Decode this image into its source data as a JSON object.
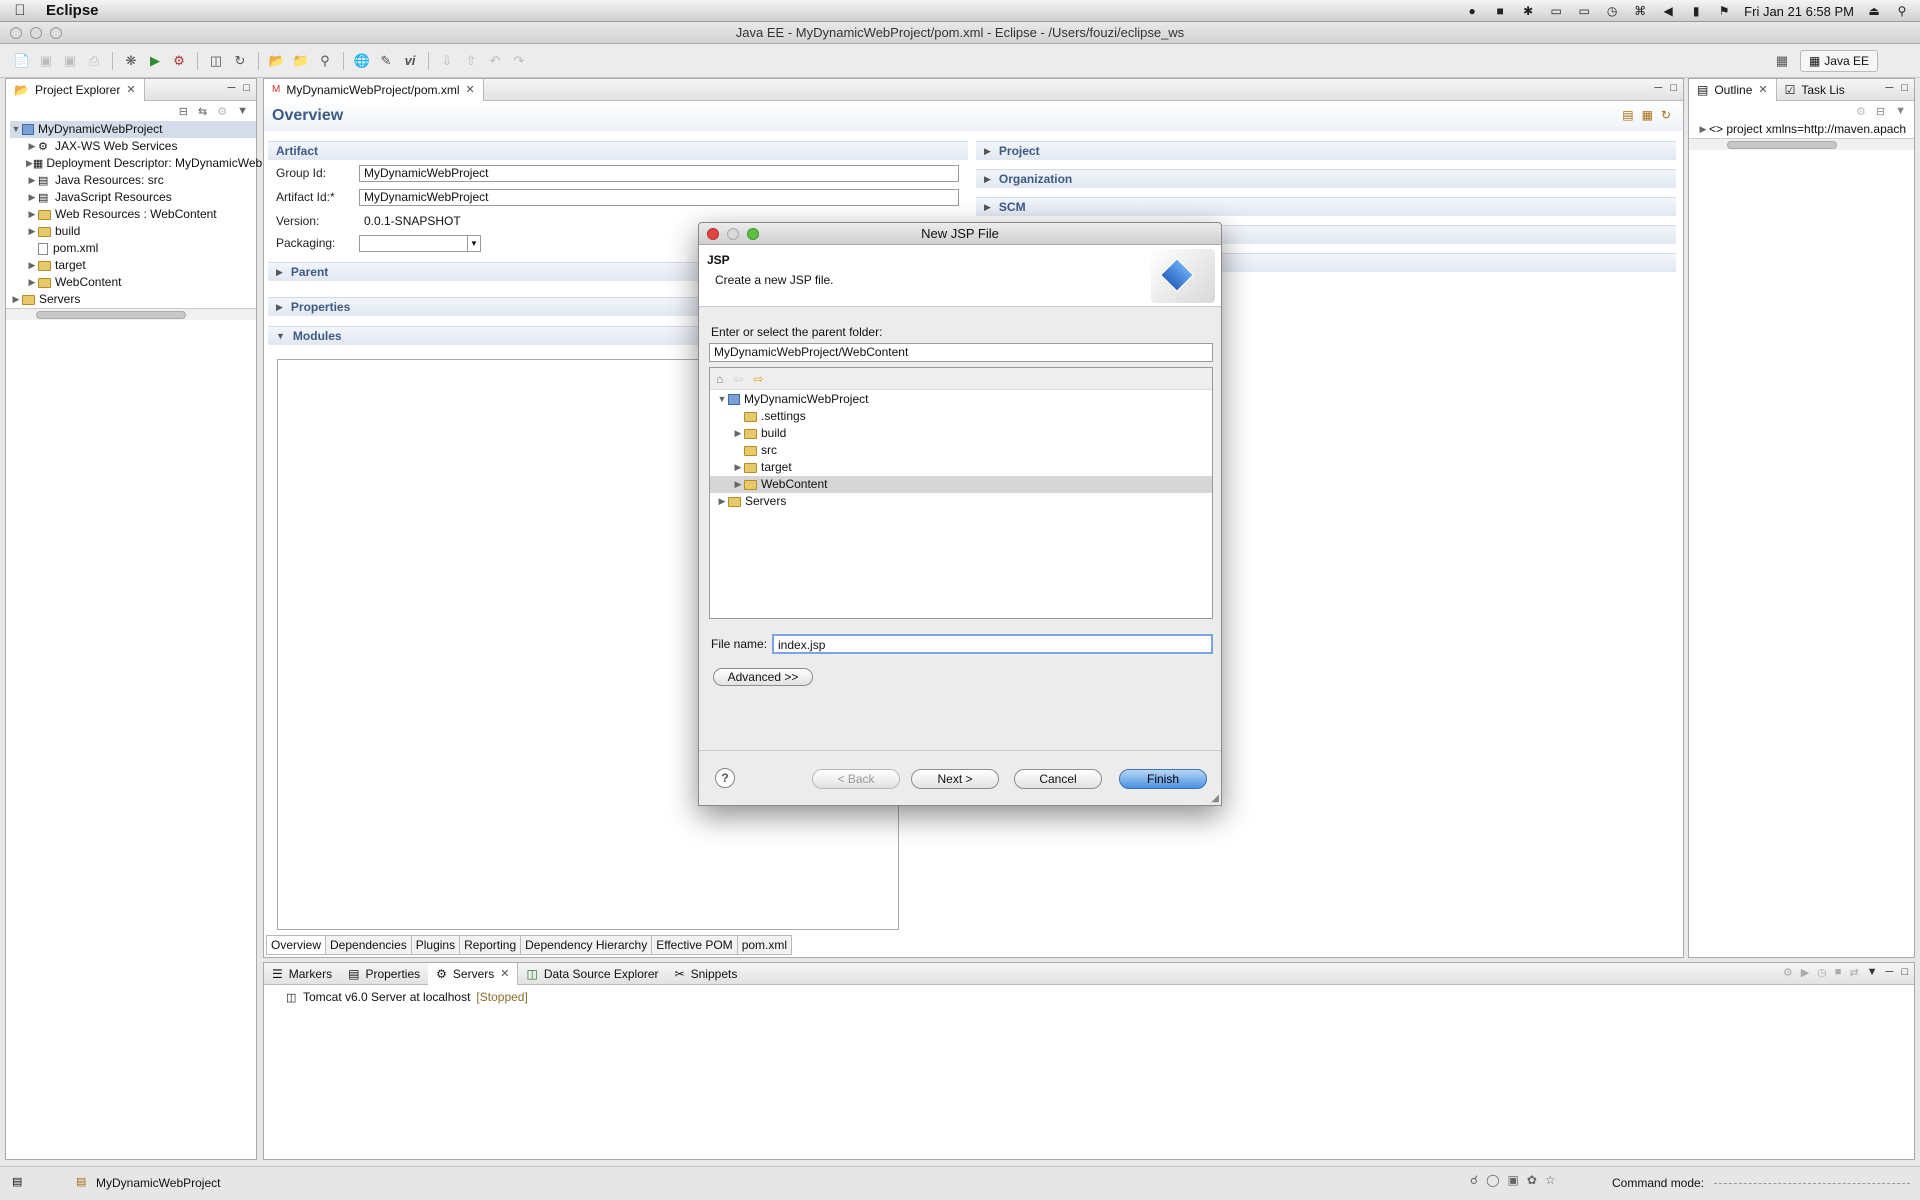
{
  "menubar": {
    "app_name": "Eclipse",
    "clock": "Fri Jan 21  6:58 PM"
  },
  "window": {
    "title": "Java EE - MyDynamicWebProject/pom.xml - Eclipse - /Users/fouzi/eclipse_ws"
  },
  "toolbar": {
    "perspective_label": "Java EE"
  },
  "project_explorer": {
    "tab_label": "Project Explorer",
    "items": [
      {
        "label": "MyDynamicWebProject"
      },
      {
        "label": "JAX-WS Web Services"
      },
      {
        "label": "Deployment Descriptor: MyDynamicWebProject"
      },
      {
        "label": "Java Resources: src"
      },
      {
        "label": "JavaScript Resources"
      },
      {
        "label": "Web Resources : WebContent"
      },
      {
        "label": "build"
      },
      {
        "label": "pom.xml"
      },
      {
        "label": "target"
      },
      {
        "label": "WebContent"
      },
      {
        "label": "Servers"
      }
    ]
  },
  "editor": {
    "tab_label": "MyDynamicWebProject/pom.xml",
    "heading": "Overview",
    "artifact_section": "Artifact",
    "group_id_label": "Group Id:",
    "group_id_value": "MyDynamicWebProject",
    "artifact_id_label": "Artifact Id:*",
    "artifact_id_value": "MyDynamicWebProject",
    "version_label": "Version:",
    "version_value": "0.0.1-SNAPSHOT",
    "packaging_label": "Packaging:",
    "parent_section": "Parent",
    "properties_section": "Properties",
    "modules_section": "Modules",
    "right_sections": [
      "Project",
      "Organization",
      "SCM"
    ],
    "bottom_tabs": [
      "Overview",
      "Dependencies",
      "Plugins",
      "Reporting",
      "Dependency Hierarchy",
      "Effective POM",
      "pom.xml"
    ]
  },
  "outline": {
    "tab_label": "Outline",
    "tab2_label": "Task Lis",
    "item": "<> project xmlns=http://maven.apach"
  },
  "servers_panel": {
    "tabs": [
      "Markers",
      "Properties",
      "Servers",
      "Data Source Explorer",
      "Snippets"
    ],
    "server_name": "Tomcat v6.0 Server at localhost",
    "server_status": "[Stopped]"
  },
  "statusbar": {
    "selection": "MyDynamicWebProject",
    "command_mode": "Command mode:"
  },
  "dialog": {
    "title": "New JSP File",
    "header_title": "JSP",
    "header_desc": "Create a new JSP file.",
    "folder_prompt": "Enter or select the parent folder:",
    "folder_value": "MyDynamicWebProject/WebContent",
    "tree": [
      {
        "label": "MyDynamicWebProject"
      },
      {
        "label": ".settings"
      },
      {
        "label": "build"
      },
      {
        "label": "src"
      },
      {
        "label": "target"
      },
      {
        "label": "WebContent"
      },
      {
        "label": "Servers"
      }
    ],
    "file_name_label": "File name:",
    "file_name_value": "index.jsp",
    "advanced_label": "Advanced >>",
    "back_label": "< Back",
    "next_label": "Next >",
    "cancel_label": "Cancel",
    "finish_label": "Finish",
    "help_label": "?"
  },
  "colors": {
    "accent": "#4a90e2",
    "section_text": "#3d5a84",
    "stopped": "#8a6d2b"
  }
}
